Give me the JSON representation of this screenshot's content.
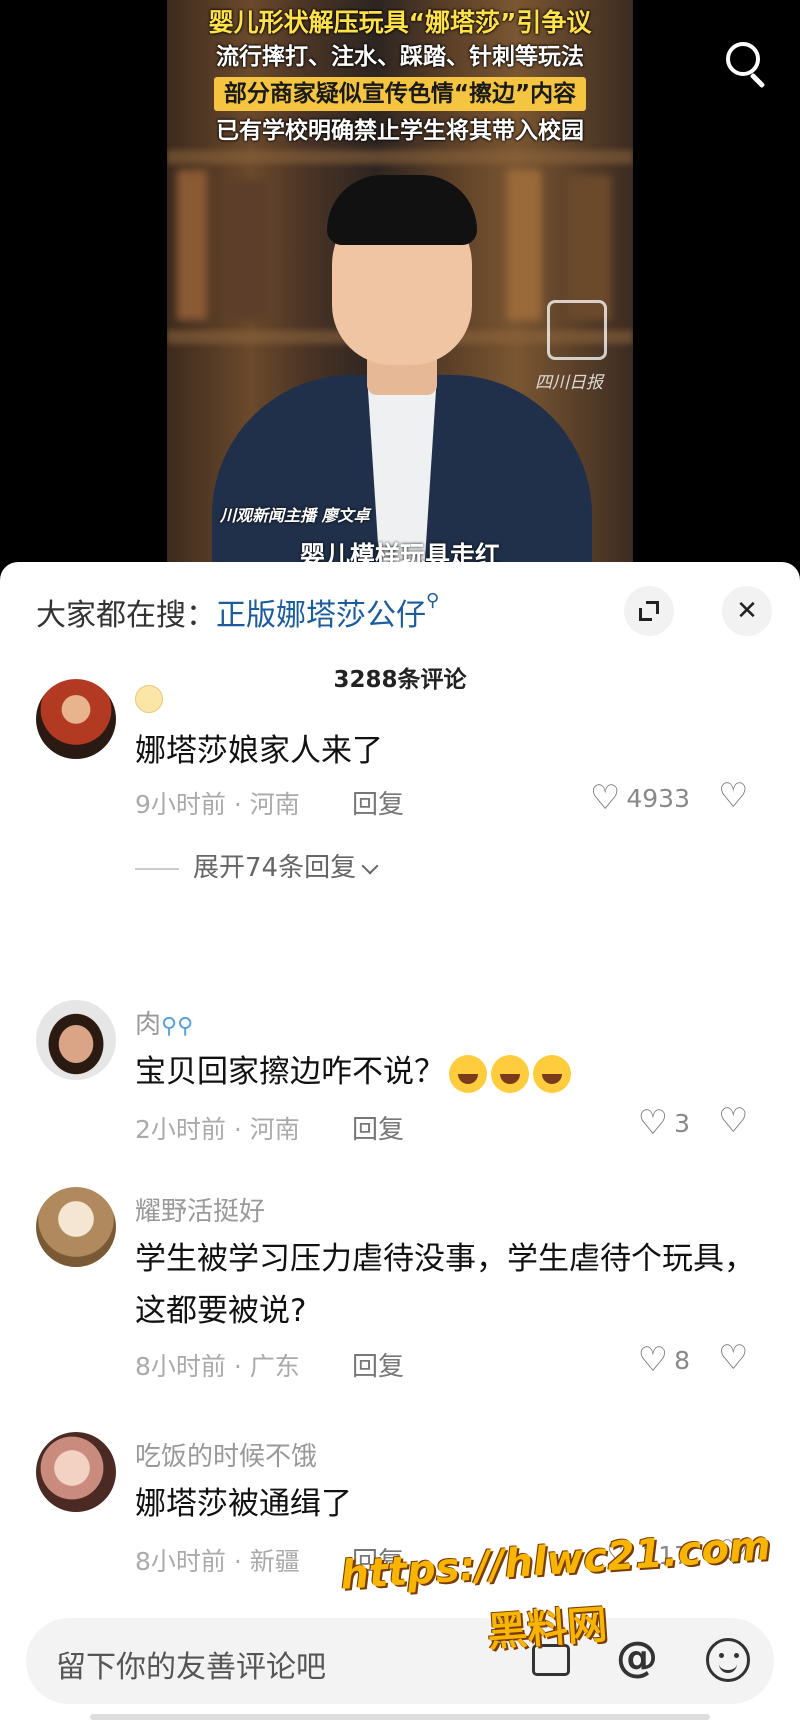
{
  "video": {
    "headline": [
      "婴儿形状解压玩具“娜塔莎”引争议",
      "流行摔打、注水、踩踏、针刺等玩法",
      "部分商家疑似宣传色情“擦边”内容",
      "已有学校明确禁止学生将其带入校园"
    ],
    "anchor_caption": "川观新闻主播 廖文卓",
    "bottom_caption": "婴儿模样玩具走红",
    "logo_text": "四川日报"
  },
  "sheet": {
    "hot_search_label": "大家都在搜：",
    "hot_search_link": "正版娜塔莎公仔",
    "close_glyph": "✕",
    "comment_count": "3288条评论"
  },
  "comments": [
    {
      "username": "",
      "text": "娜塔莎娘家人来了",
      "meta": "9小时前 · 河南",
      "reply": "回复",
      "likes": "4933",
      "expand_replies": "展开74条回复"
    },
    {
      "username": "肉",
      "text": "宝贝回家擦边咋不说？",
      "meta": "2小时前 · 河南",
      "reply": "回复",
      "likes": "3"
    },
    {
      "username": "耀野活挺好",
      "text": "学生被学习压力虐待没事，学生虐待个玩具，这都要被说?",
      "meta": "8小时前 · 广东",
      "reply": "回复",
      "likes": "8"
    },
    {
      "username": "吃饭的时候不饿",
      "text": "娜塔莎被通缉了",
      "meta": "8小时前 · 新疆",
      "reply": "回复",
      "likes": "217"
    }
  ],
  "input": {
    "placeholder": "留下你的友善评论吧"
  },
  "overlay": {
    "url": "https://hlwc21.com",
    "site": "黑料网"
  }
}
